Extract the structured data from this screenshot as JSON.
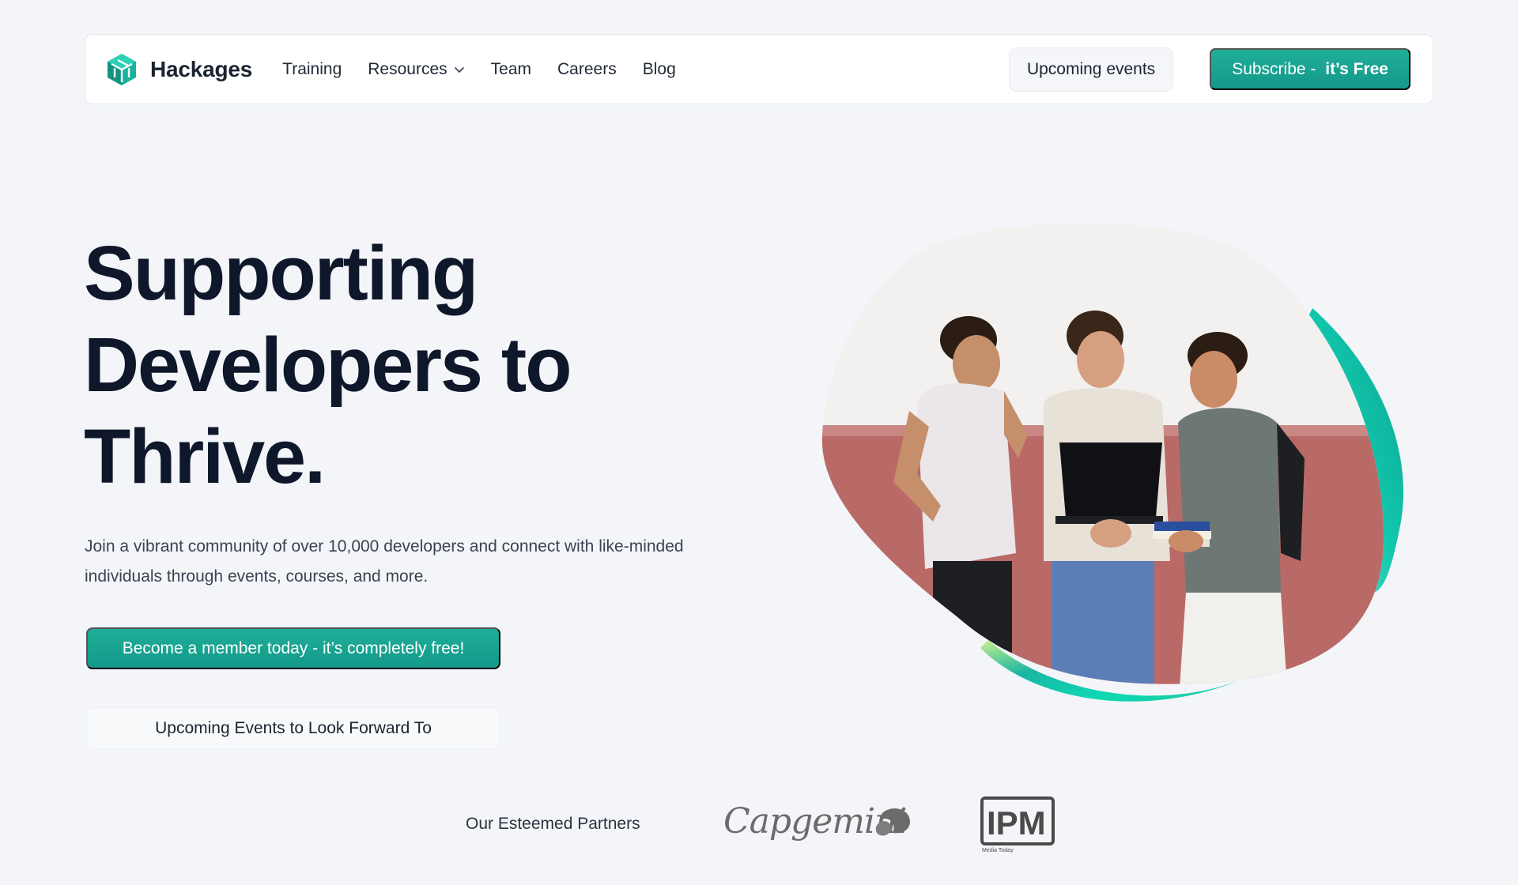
{
  "nav": {
    "brand": "Hackages",
    "links": [
      {
        "label": "Training"
      },
      {
        "label": "Resources",
        "has_dropdown": true
      },
      {
        "label": "Team"
      },
      {
        "label": "Careers"
      },
      {
        "label": "Blog"
      }
    ],
    "events_button": "Upcoming events",
    "subscribe_prefix": "Subscribe - ",
    "subscribe_bold": "it’s Free"
  },
  "hero": {
    "title_lines": [
      "Supporting",
      "Developers to",
      "Thrive."
    ],
    "description": "Join a vibrant community of over 10,000 developers and connect with like-minded individuals through events, courses, and more.",
    "primary_cta": "Become a member today - it’s completely free!",
    "secondary_cta": "Upcoming Events to Look Forward To"
  },
  "partners": {
    "label": "Our Esteemed Partners",
    "logos": [
      {
        "name": "Capgemini",
        "icon": "capgemini-logo"
      },
      {
        "name": "IPM",
        "subtext": "Media Today",
        "icon": "ipm-logo"
      }
    ]
  },
  "colors": {
    "accent": "#17a291",
    "background": "#f3f5f9",
    "heading": "#0f172a",
    "partner_logo": "#6b6b6b"
  },
  "icons": {
    "brand": "hackages-cube-icon",
    "dropdown": "chevron-down-icon"
  }
}
